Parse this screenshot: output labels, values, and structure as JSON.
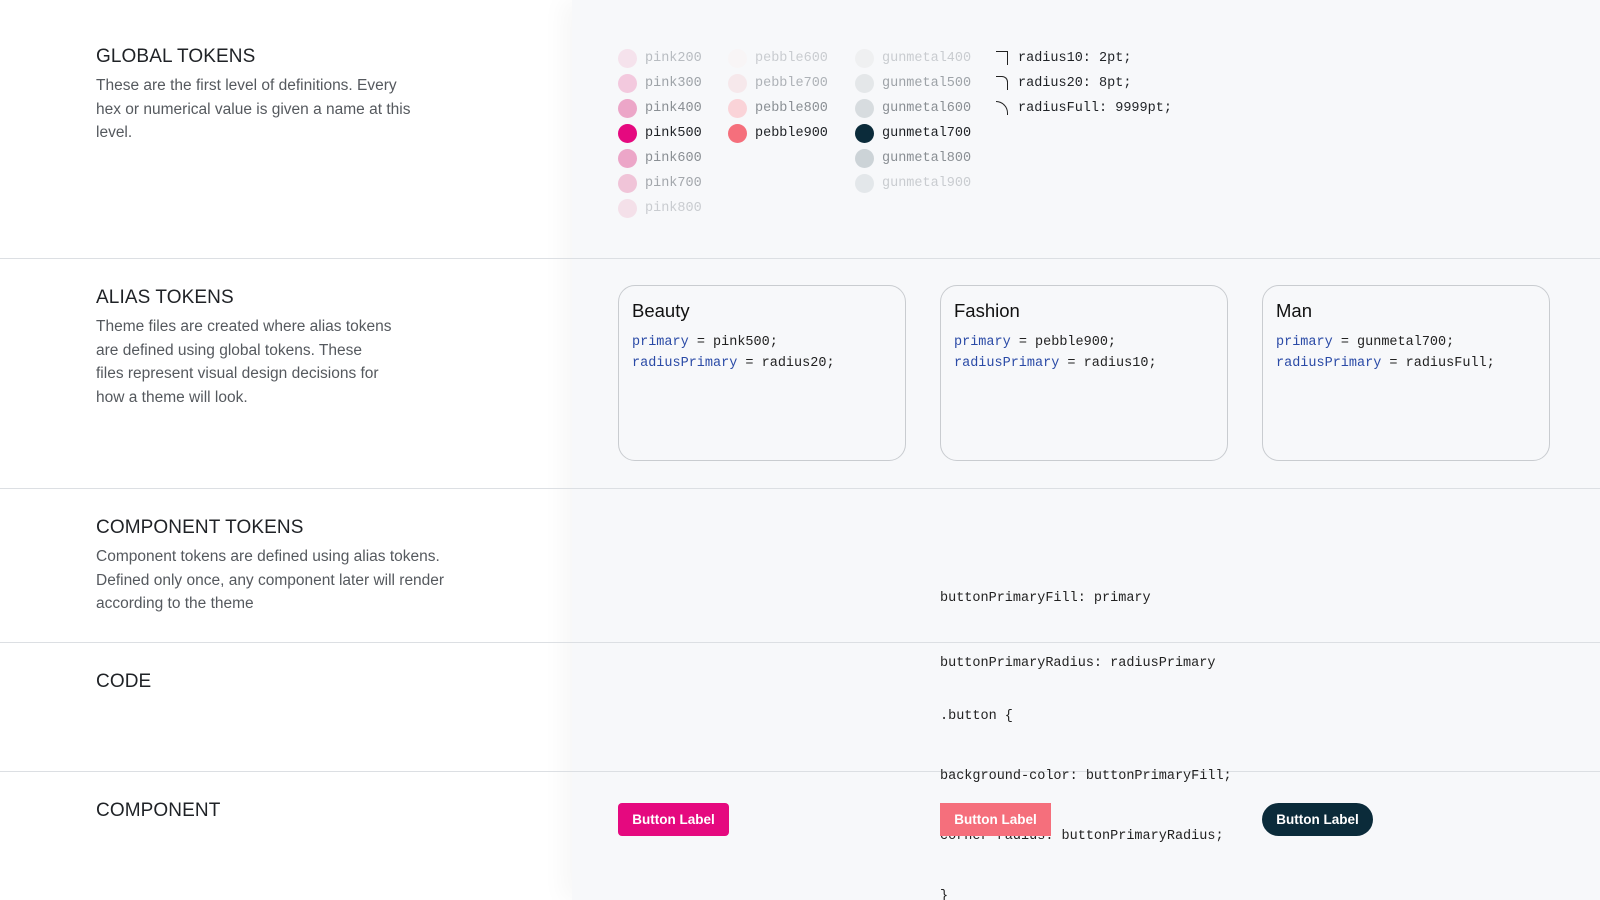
{
  "sections": {
    "global": {
      "title": "GLOBAL TOKENS",
      "desc_lines": [
        "These are the first level of definitions. Every",
        "hex or numerical value is given a name at this",
        "level."
      ]
    },
    "alias": {
      "title": "ALIAS TOKENS",
      "desc_lines": [
        "Theme files are created where alias tokens",
        "are defined using global tokens. These",
        "files represent visual design decisions for",
        "how a theme will look."
      ]
    },
    "component_tokens": {
      "title": "COMPONENT TOKENS",
      "desc_lines": [
        "Component tokens are defined using alias tokens.",
        "Defined only once, any component later will render",
        "according to the theme"
      ]
    },
    "code": {
      "title": "CODE"
    },
    "component": {
      "title": "COMPONENT"
    }
  },
  "global_tokens": {
    "pink": [
      {
        "name": "pink200",
        "color": "#f5e2ec",
        "text_color": "#b8bcc1"
      },
      {
        "name": "pink300",
        "color": "#f3c9de",
        "text_color": "#9ea3a8"
      },
      {
        "name": "pink400",
        "color": "#eca6c8",
        "text_color": "#8a8f94"
      },
      {
        "name": "pink500",
        "color": "#e5097f",
        "text_color": "#1f2226"
      },
      {
        "name": "pink600",
        "color": "#eca6c8",
        "text_color": "#8a8f94"
      },
      {
        "name": "pink700",
        "color": "#f0c4d8",
        "text_color": "#a3a7ac"
      },
      {
        "name": "pink800",
        "color": "#f4e0e9",
        "text_color": "#c9ccd0"
      }
    ],
    "pebble": [
      {
        "name": "pebble600",
        "color": "#f8f5f6",
        "text_color": "#c9ccd0"
      },
      {
        "name": "pebble700",
        "color": "#f6e8eb",
        "text_color": "#aeb2b7"
      },
      {
        "name": "pebble800",
        "color": "#fad3d8",
        "text_color": "#8a8f94"
      },
      {
        "name": "pebble900",
        "color": "#f56f7c",
        "text_color": "#1f2226"
      }
    ],
    "gunmetal": [
      {
        "name": "gunmetal400",
        "color": "#eff0f1",
        "text_color": "#c9ccd0"
      },
      {
        "name": "gunmetal500",
        "color": "#e4e7e9",
        "text_color": "#9ea3a8"
      },
      {
        "name": "gunmetal600",
        "color": "#d7dcdf",
        "text_color": "#8a8f94"
      },
      {
        "name": "gunmetal700",
        "color": "#0b2b3a",
        "text_color": "#1f2226"
      },
      {
        "name": "gunmetal800",
        "color": "#ccd3d7",
        "text_color": "#8a8f94"
      },
      {
        "name": "gunmetal900",
        "color": "#e3e7ea",
        "text_color": "#c9ccd0"
      }
    ],
    "radius": [
      {
        "label": "radius10: 2pt;",
        "shape": "square-corner"
      },
      {
        "label": "radius20: 8pt;",
        "shape": "small-round-corner"
      },
      {
        "label": "radiusFull: 9999pt;",
        "shape": "full-round-corner"
      }
    ]
  },
  "themes": [
    {
      "name": "Beauty",
      "primary_key": "primary",
      "primary_value": " = pink500;",
      "radius_key": "radiusPrimary",
      "radius_value": " = radius20;"
    },
    {
      "name": "Fashion",
      "primary_key": "primary",
      "primary_value": " = pebble900;",
      "radius_key": "radiusPrimary",
      "radius_value": " = radius10;"
    },
    {
      "name": "Man",
      "primary_key": "primary",
      "primary_value": " = gunmetal700;",
      "radius_key": "radiusPrimary",
      "radius_value": " = radiusFull;"
    }
  ],
  "component_tokens_code": [
    "buttonPrimaryFill: primary",
    "buttonPrimaryRadius: radiusPrimary"
  ],
  "code_block": [
    ".button {",
    "background-color: buttonPrimaryFill;",
    "corner-radius: buttonPrimaryRadius;",
    "}"
  ],
  "buttons": [
    {
      "label": "Button Label",
      "color": "#e5097f",
      "corner": "rounded-small"
    },
    {
      "label": "Button Label",
      "color": "#f56f7c",
      "corner": "square"
    },
    {
      "label": "Button Label",
      "color": "#0b2b3a",
      "corner": "pill"
    }
  ]
}
